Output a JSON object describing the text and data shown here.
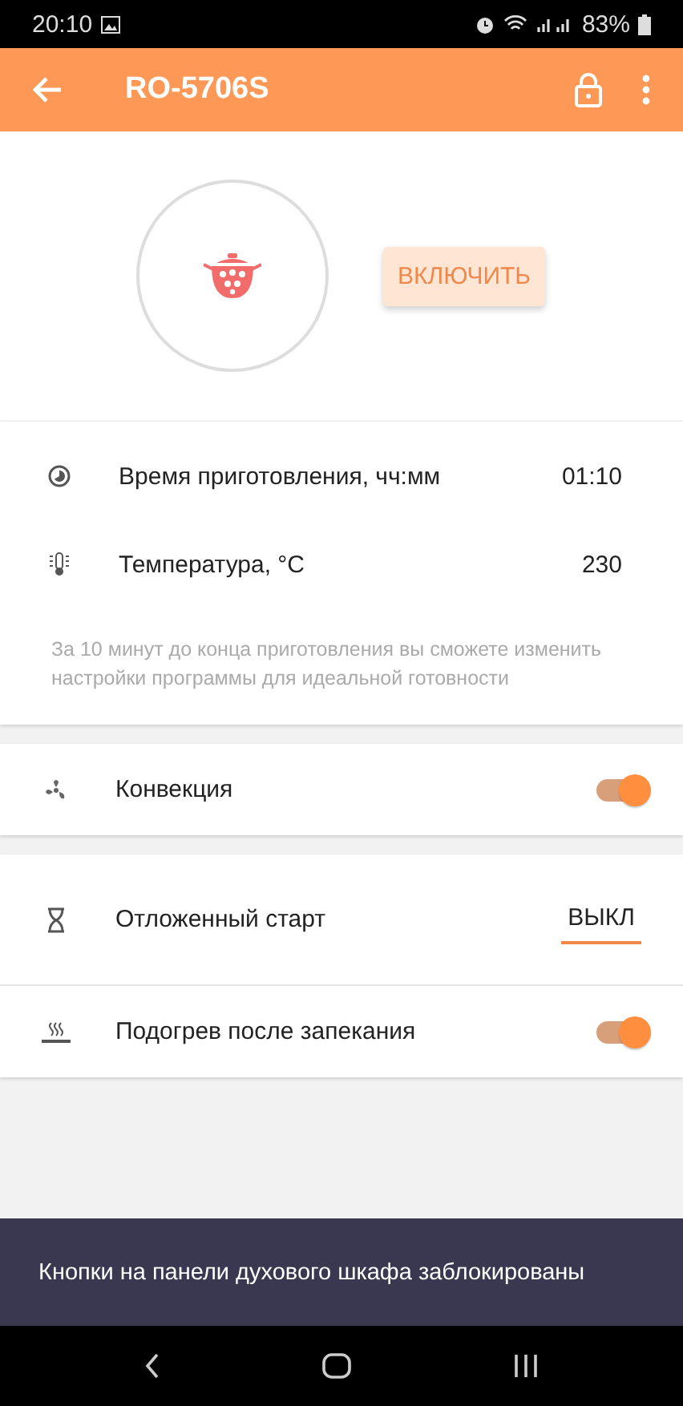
{
  "status_bar": {
    "time": "20:10",
    "battery": "83%"
  },
  "app_bar": {
    "title": "RO-5706S"
  },
  "program": {
    "button": "ВКЛЮЧИТЬ"
  },
  "parameters": [
    {
      "label": "Время приготовления, чч:мм",
      "value": "01:10"
    },
    {
      "label": "Температура, °C",
      "value": "230"
    }
  ],
  "note": "За 10 минут до конца приготовления вы сможете изменить настройки программы для идеальной готовности",
  "option_groups": [
    [
      {
        "kind": "toggle",
        "label": "Конвекция",
        "on": true
      }
    ],
    [
      {
        "kind": "select",
        "label": "Отложенный старт",
        "value": "ВЫКЛ"
      },
      {
        "kind": "toggle",
        "label": "Подогрев после запекания",
        "on": true
      }
    ]
  ],
  "snackbar": "Кнопки на панели духового шкафа заблокированы"
}
